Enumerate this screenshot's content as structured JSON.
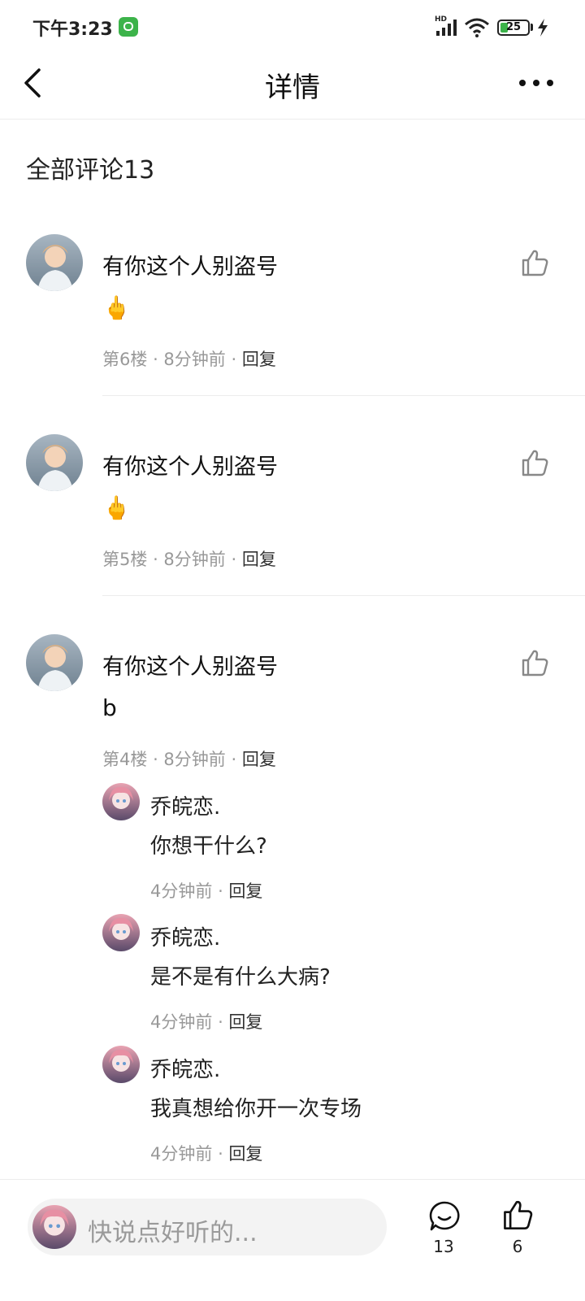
{
  "status_bar": {
    "time": "下午3:23",
    "hd": "HD",
    "battery": "25"
  },
  "header": {
    "title": "详情"
  },
  "section_title": "全部评论13",
  "comments": [
    {
      "name": "有你这个人别盗号",
      "content": "🖕",
      "floor": "第6楼",
      "time": "8分钟前",
      "reply": "回复"
    },
    {
      "name": "有你这个人别盗号",
      "content": "🖕",
      "floor": "第5楼",
      "time": "8分钟前",
      "reply": "回复"
    },
    {
      "name": "有你这个人别盗号",
      "content": "b",
      "floor": "第4楼",
      "time": "8分钟前",
      "reply": "回复",
      "replies": [
        {
          "name": "乔皖恋.",
          "content": "你想干什么?",
          "time": "4分钟前",
          "reply": "回复"
        },
        {
          "name": "乔皖恋.",
          "content": "是不是有什么大病?",
          "time": "4分钟前",
          "reply": "回复"
        },
        {
          "name": "乔皖恋.",
          "content": "我真想给你开一次专场",
          "time": "4分钟前",
          "reply": "回复"
        }
      ]
    }
  ],
  "bottom_bar": {
    "input_placeholder": "快说点好听的...",
    "comment_count": "13",
    "like_count": "6"
  },
  "colors": {
    "accent_green": "#3cb34a",
    "muted_text": "#999999",
    "divider": "#ececec"
  },
  "icons": [
    "back-arrow-icon",
    "more-icon",
    "thumbs-up-icon",
    "comment-bubble-icon",
    "wifi-icon",
    "signal-icon",
    "battery-icon",
    "charging-bolt-icon"
  ]
}
